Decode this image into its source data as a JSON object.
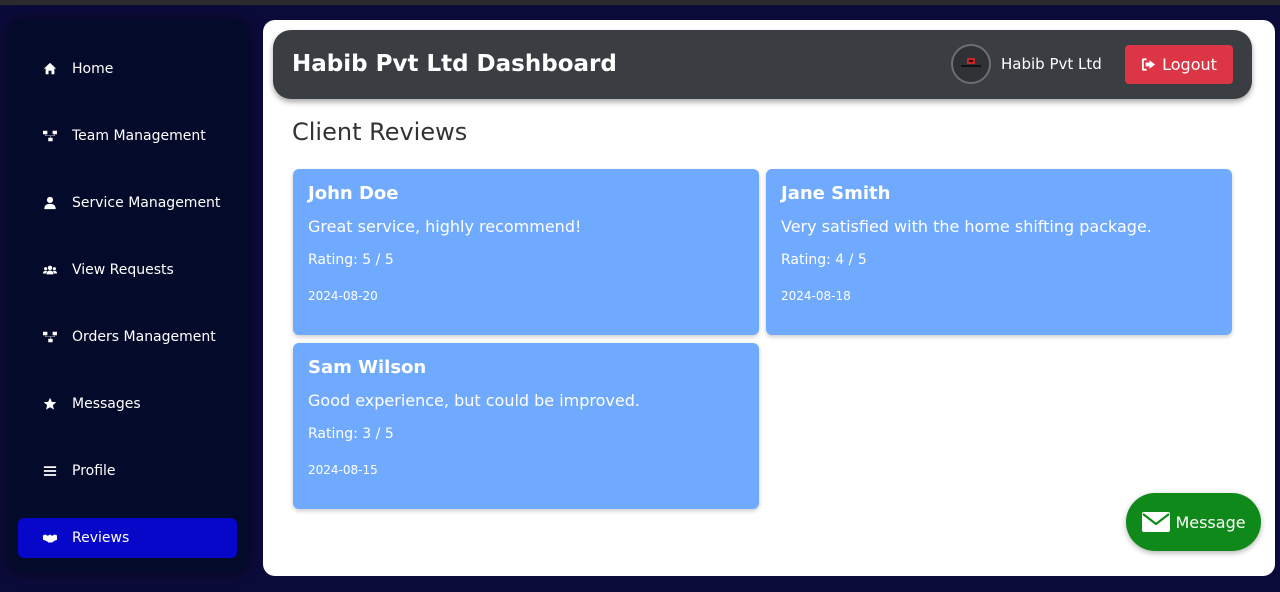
{
  "sidebar": {
    "items": [
      {
        "label": "Home",
        "icon": "home-icon"
      },
      {
        "label": "Team Management",
        "icon": "sitemap-icon"
      },
      {
        "label": "Service Management",
        "icon": "user-icon"
      },
      {
        "label": "View Requests",
        "icon": "users-icon"
      },
      {
        "label": "Orders Management",
        "icon": "sitemap-icon"
      },
      {
        "label": "Messages",
        "icon": "star-icon"
      },
      {
        "label": "Profile",
        "icon": "bars-icon"
      },
      {
        "label": "Reviews",
        "icon": "handshake-icon",
        "active": true
      }
    ]
  },
  "header": {
    "title": "Habib Pvt Ltd Dashboard",
    "company_name": "Habib Pvt Ltd",
    "logout_label": "Logout"
  },
  "main": {
    "section_title": "Client Reviews",
    "reviews": [
      {
        "name": "John Doe",
        "comment": "Great service, highly recommend!",
        "rating": "Rating: 5 / 5",
        "date": "2024-08-20"
      },
      {
        "name": "Jane Smith",
        "comment": "Very satisfied with the home shifting package.",
        "rating": "Rating: 4 / 5",
        "date": "2024-08-18"
      },
      {
        "name": "Sam Wilson",
        "comment": "Good experience, but could be improved.",
        "rating": "Rating: 3 / 5",
        "date": "2024-08-15"
      }
    ]
  },
  "floating": {
    "message_label": "Message"
  },
  "colors": {
    "sidebar_bg": "#040a2a",
    "active_item": "#0707c9",
    "card_bg": "#70aaff",
    "logout": "#dc3545",
    "message_btn": "#0f8a1a",
    "header_bg": "#3a3d41"
  }
}
